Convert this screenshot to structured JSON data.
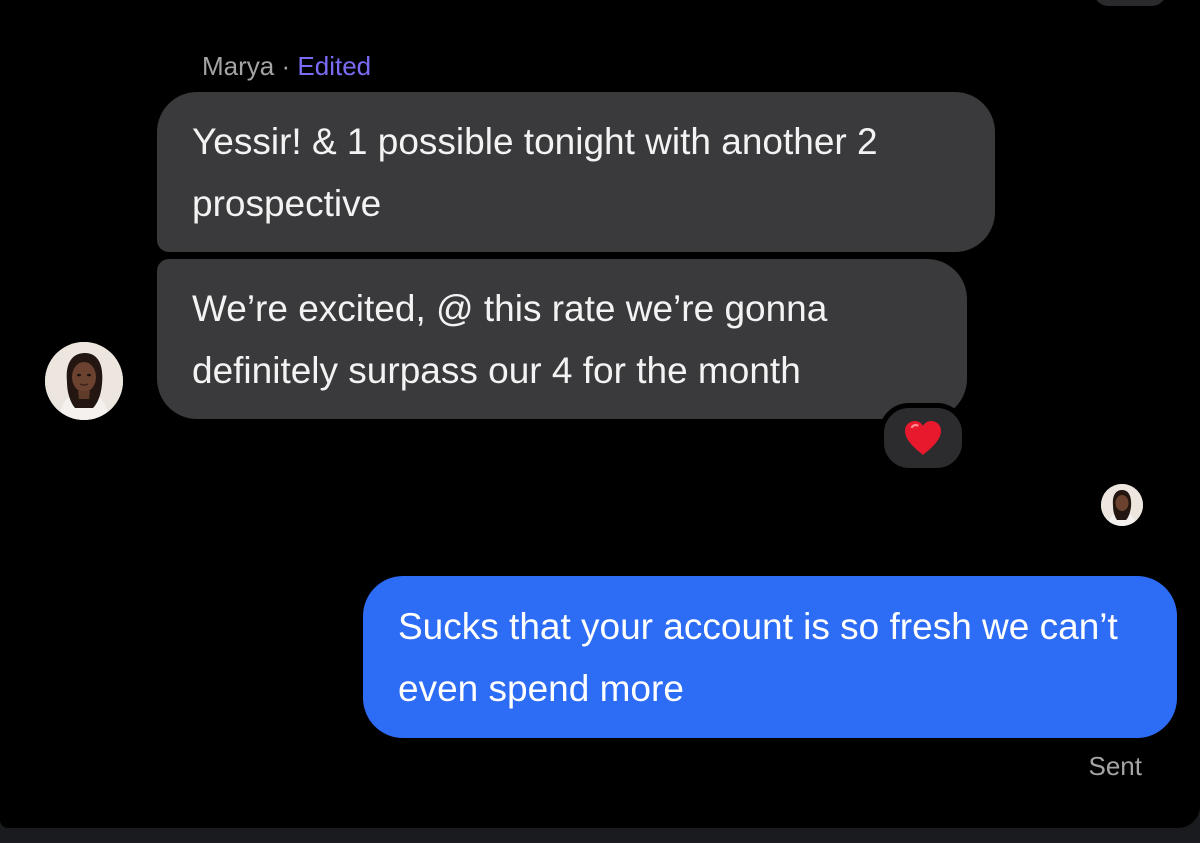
{
  "conversation": {
    "sender_name": "Marya",
    "separator": "·",
    "edited_label": "Edited",
    "messages": [
      {
        "direction": "incoming",
        "text": "Yessir! & 1 possible tonight with another 2 prospective"
      },
      {
        "direction": "incoming",
        "text": "We’re excited, @ this rate we’re gonna definitely surpass our 4 for the month",
        "reaction": "red-heart"
      },
      {
        "direction": "outgoing",
        "text": "Sucks that your account is so fresh we can’t even spend more",
        "status": "Sent"
      }
    ]
  },
  "icons": {
    "reaction": "red-heart-icon",
    "avatar": "contact-avatar"
  },
  "colors": {
    "background": "#000000",
    "incoming_bubble": "#3a3a3c",
    "outgoing_bubble": "#2d6cf5",
    "edited_accent": "#7b6cf6",
    "meta_text": "#a4a4a6",
    "heart": "#e8192c"
  }
}
